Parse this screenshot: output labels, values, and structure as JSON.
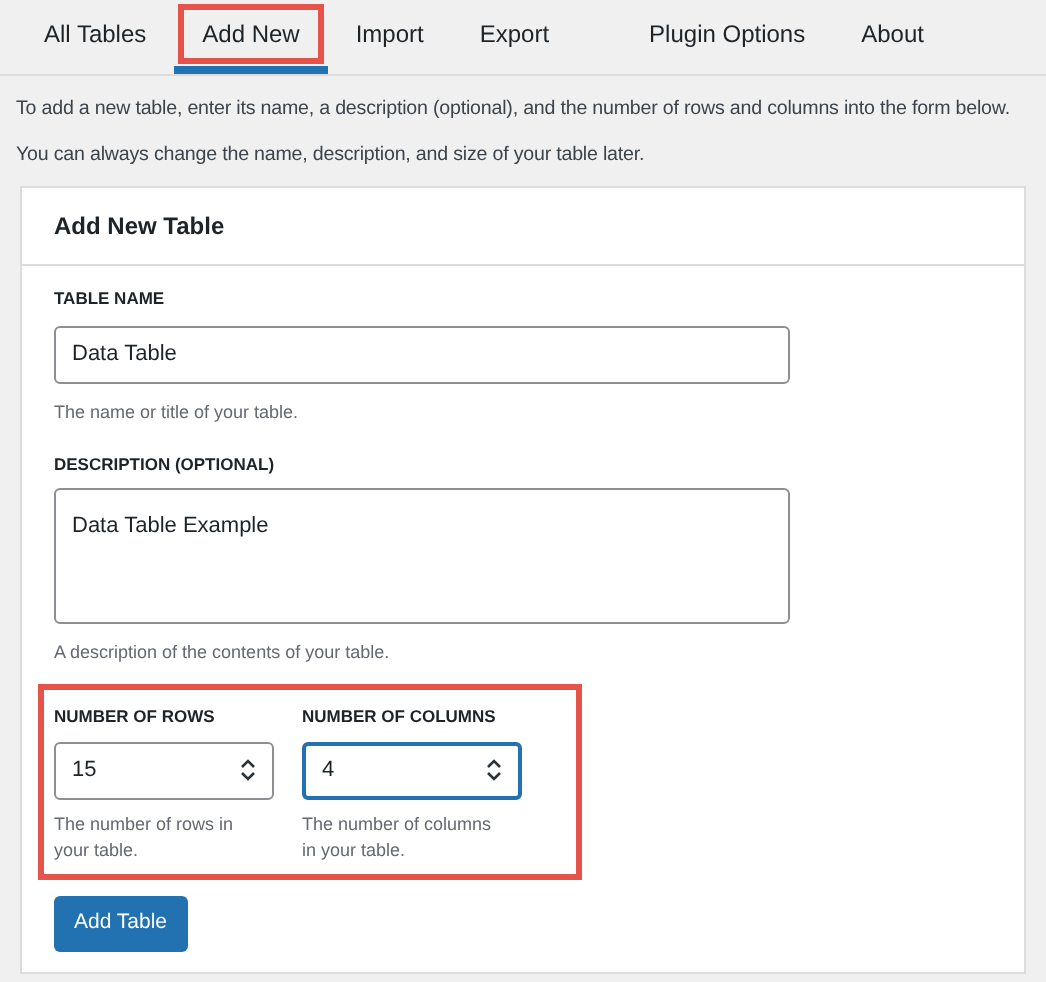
{
  "tabs": [
    {
      "label": "All Tables",
      "selected": false
    },
    {
      "label": "Add New",
      "selected": true
    },
    {
      "label": "Import",
      "selected": false
    },
    {
      "label": "Export",
      "selected": false
    },
    {
      "label": "Plugin Options",
      "selected": false
    },
    {
      "label": "About",
      "selected": false
    }
  ],
  "intro": [
    "To add a new table, enter its name, a description (optional), and the number of rows and columns into the form below.",
    "You can always change the name, description, and size of your table later."
  ],
  "card": {
    "title": "Add New Table",
    "name_field": {
      "label": "TABLE NAME",
      "value": "Data Table",
      "help": "The name or title of your table."
    },
    "description_field": {
      "label": "DESCRIPTION (OPTIONAL)",
      "value": "Data Table Example",
      "help": "A description of the contents of your table."
    },
    "size_fields": [
      {
        "label": "NUMBER OF ROWS",
        "value": "15",
        "help": "The number of rows in your table.",
        "focused": false
      },
      {
        "label": "NUMBER OF COLUMNS",
        "value": "4",
        "help": "The number of columns in your table.",
        "focused": true
      }
    ],
    "submit": "Add Table"
  }
}
